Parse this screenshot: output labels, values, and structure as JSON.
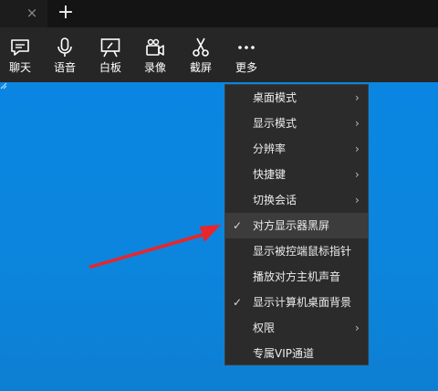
{
  "tabbar": {
    "close_icon": "×",
    "new_tab_icon": "+"
  },
  "toolbar": [
    {
      "label": "聊天",
      "icon": "chat-icon"
    },
    {
      "label": "语音",
      "icon": "microphone-icon"
    },
    {
      "label": "白板",
      "icon": "whiteboard-icon"
    },
    {
      "label": "录像",
      "icon": "video-camera-icon"
    },
    {
      "label": "截屏",
      "icon": "scissors-icon"
    },
    {
      "label": "更多",
      "icon": "more-icon"
    }
  ],
  "menu": {
    "items": [
      {
        "label": "桌面模式",
        "submenu": true,
        "checked": false
      },
      {
        "label": "显示模式",
        "submenu": true,
        "checked": false
      },
      {
        "label": "分辨率",
        "submenu": true,
        "checked": false
      },
      {
        "label": "快捷键",
        "submenu": true,
        "checked": false
      },
      {
        "label": "切换会话",
        "submenu": true,
        "checked": false
      },
      {
        "label": "对方显示器黑屏",
        "submenu": false,
        "checked": true,
        "highlighted": true
      },
      {
        "label": "显示被控端鼠标指针",
        "submenu": false,
        "checked": false
      },
      {
        "label": "播放对方主机声音",
        "submenu": false,
        "checked": false
      },
      {
        "label": "显示计算机桌面背景",
        "submenu": false,
        "checked": true
      },
      {
        "label": "权限",
        "submenu": true,
        "checked": false
      },
      {
        "label": "专属VIP通道",
        "submenu": false,
        "checked": false
      }
    ],
    "check_glyph": "✓",
    "arrow_glyph": "›"
  },
  "colors": {
    "desktop": "#0b82de",
    "toolbar": "#262626",
    "menu": "#2b2b2b",
    "menu_highlight": "#3c3c3c",
    "annotation_arrow": "#e8262b"
  }
}
